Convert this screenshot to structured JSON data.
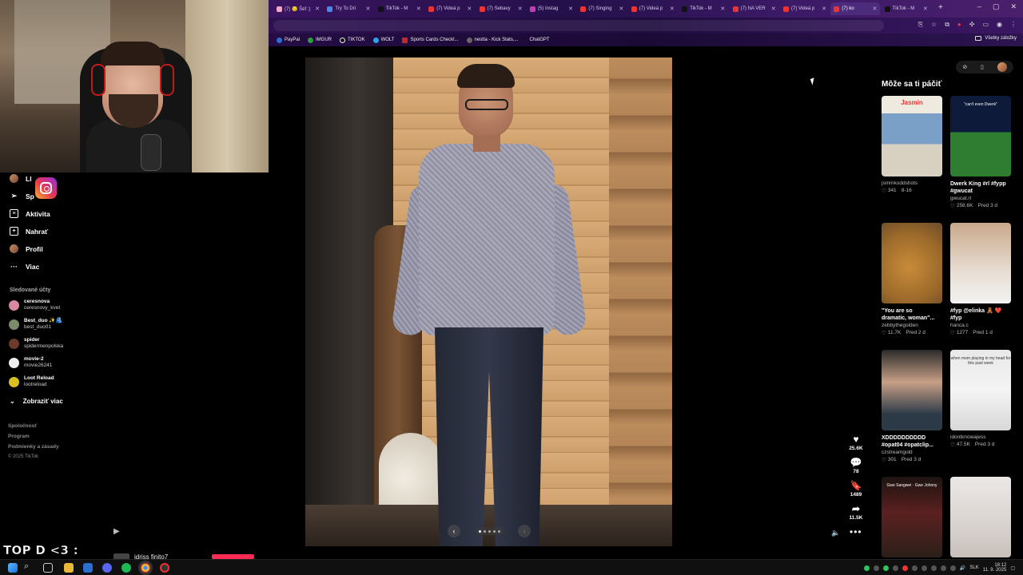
{
  "browser": {
    "tabs": [
      {
        "label": "(7) 😏 Šéf :)"
      },
      {
        "label": "Try To Dri"
      },
      {
        "label": "TikTok - M"
      },
      {
        "label": "(7) Videá p"
      },
      {
        "label": "(7) Sebavy"
      },
      {
        "label": "(5) Instag"
      },
      {
        "label": "(7) Singing"
      },
      {
        "label": "(7) Videá p"
      },
      {
        "label": "TikTok - M"
      },
      {
        "label": "(7) NA VER"
      },
      {
        "label": "(7) Videá p"
      },
      {
        "label": "(7) ko"
      },
      {
        "label": "TikTok - M"
      }
    ],
    "new_tab": "+",
    "window_controls": {
      "minimize": "–",
      "maximize": "▢",
      "close": "✕"
    },
    "bookmarks": [
      "PayPal",
      "IMGUR",
      "TIKTOK",
      "WOLT",
      "Sports Cards Checkl...",
      "nestta - Kick Stats,...",
      "ChatGPT"
    ],
    "all_bookmarks": "Všetky záložky"
  },
  "sidebar": {
    "nav": [
      {
        "label": "LI",
        "icon": "live-icon"
      },
      {
        "label": "Sp",
        "icon": "messages-icon"
      },
      {
        "label": "Aktivita",
        "icon": "activity-icon"
      },
      {
        "label": "Nahrať",
        "icon": "upload-icon"
      },
      {
        "label": "Profil",
        "icon": "profile-icon"
      },
      {
        "label": "Viac",
        "icon": "more-icon"
      }
    ],
    "following_title": "Sledované účty",
    "accounts": [
      {
        "name": "ceresnova",
        "handle": "ceresnovy_kvet",
        "color": "#d88aa0"
      },
      {
        "name": "Best_duo ✨🫂",
        "handle": "best_duo01",
        "color": "#7a8a6a"
      },
      {
        "name": "spider",
        "handle": "spidermenpolska",
        "color": "#6b3a2a"
      },
      {
        "name": "movie-2",
        "handle": "movie26241",
        "color": "#eeeeee"
      },
      {
        "name": "Loot Reload",
        "handle": "lootreload",
        "color": "#d8c020"
      }
    ],
    "show_more": "Zobraziť viac",
    "footer": [
      "Spoločnosť",
      "Program",
      "Podmienky a zásady",
      "© 2025 TikTok"
    ]
  },
  "overlay": {
    "stream_text": "TOP D <3 :",
    "bottom_user": "idriss finito7"
  },
  "post": {
    "carousel_dots": 5,
    "carousel_active": 0,
    "actions": {
      "likes": "25.6K",
      "comments": "78",
      "saves": "1489",
      "shares": "11.5K"
    }
  },
  "recommendations": {
    "title": "Môže sa ti páčiť",
    "cards": [
      {
        "title": "",
        "author": "jsmmkoddshots",
        "likes": "341",
        "date": "8-16",
        "cap": "Jasmin",
        "thumb": "t1"
      },
      {
        "title": "Dwerk King #rl #fypp\n#gwucat",
        "author": "gwucat.rl",
        "likes": "258.6K",
        "date": "Pred 3 d",
        "cap": "\"can't even Dwerk\"",
        "thumb": "t2"
      },
      {
        "title": "\"You are so\ndramatic, woman\"...",
        "author": "zebbythegolden",
        "likes": "11.7K",
        "date": "Pred 2 d",
        "cap": "",
        "thumb": "t3"
      },
      {
        "title": "#fyp @elinka 🧸 ❤️\n#fyp",
        "author": "hanca.c",
        "likes": "1277",
        "date": "Pred 1 d",
        "cap": "",
        "thumb": "t4"
      },
      {
        "title": "XDDDDDDDDDD\n#opat04 #opatclip...",
        "author": "czstreamgold",
        "likes": "301",
        "date": "Pred 3 d",
        "cap": "",
        "thumb": "t5"
      },
      {
        "title": "",
        "author": "idontknowajess",
        "likes": "47.5K",
        "date": "Pred 3 d",
        "cap": "when mom playing in my head for this past week",
        "thumb": "t6"
      },
      {
        "title": "",
        "author": "",
        "likes": "",
        "date": "",
        "cap": "Gwe Sangwei · Gwe Johnny",
        "thumb": "t7"
      },
      {
        "title": "",
        "author": "",
        "likes": "",
        "date": "",
        "cap": "",
        "thumb": "t8"
      }
    ]
  },
  "taskbar": {
    "lang": "SLK",
    "time": "18:12",
    "date": "11. 9. 2025"
  }
}
